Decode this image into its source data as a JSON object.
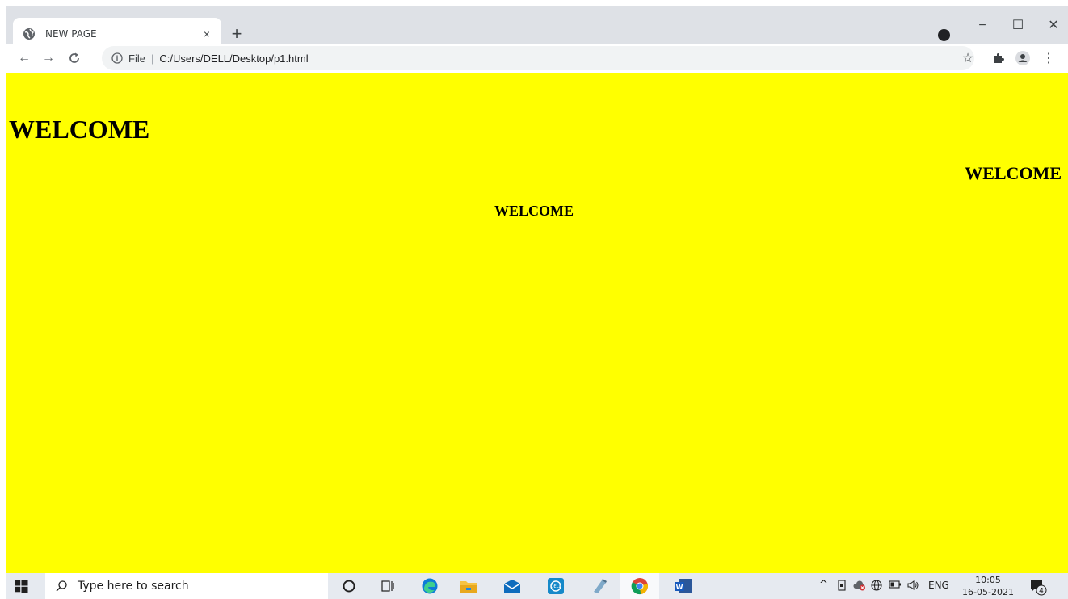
{
  "browser": {
    "tab_title": "NEW PAGE",
    "tab_close": "×",
    "new_tab": "+",
    "window_minimize": "−",
    "window_maximize": "☐",
    "window_close": "✕",
    "address": {
      "scheme_label": "File",
      "separator": "|",
      "path": "C:/Users/DELL/Desktop/p1.html"
    }
  },
  "page": {
    "background_color": "#ffff00",
    "heading_large": "WELCOME",
    "heading_right": "WELCOME",
    "heading_center": "WELCOME"
  },
  "taskbar": {
    "search_placeholder": "Type here to search",
    "language": "ENG",
    "time": "10:05",
    "date": "16-05-2021",
    "notification_count": "4"
  }
}
